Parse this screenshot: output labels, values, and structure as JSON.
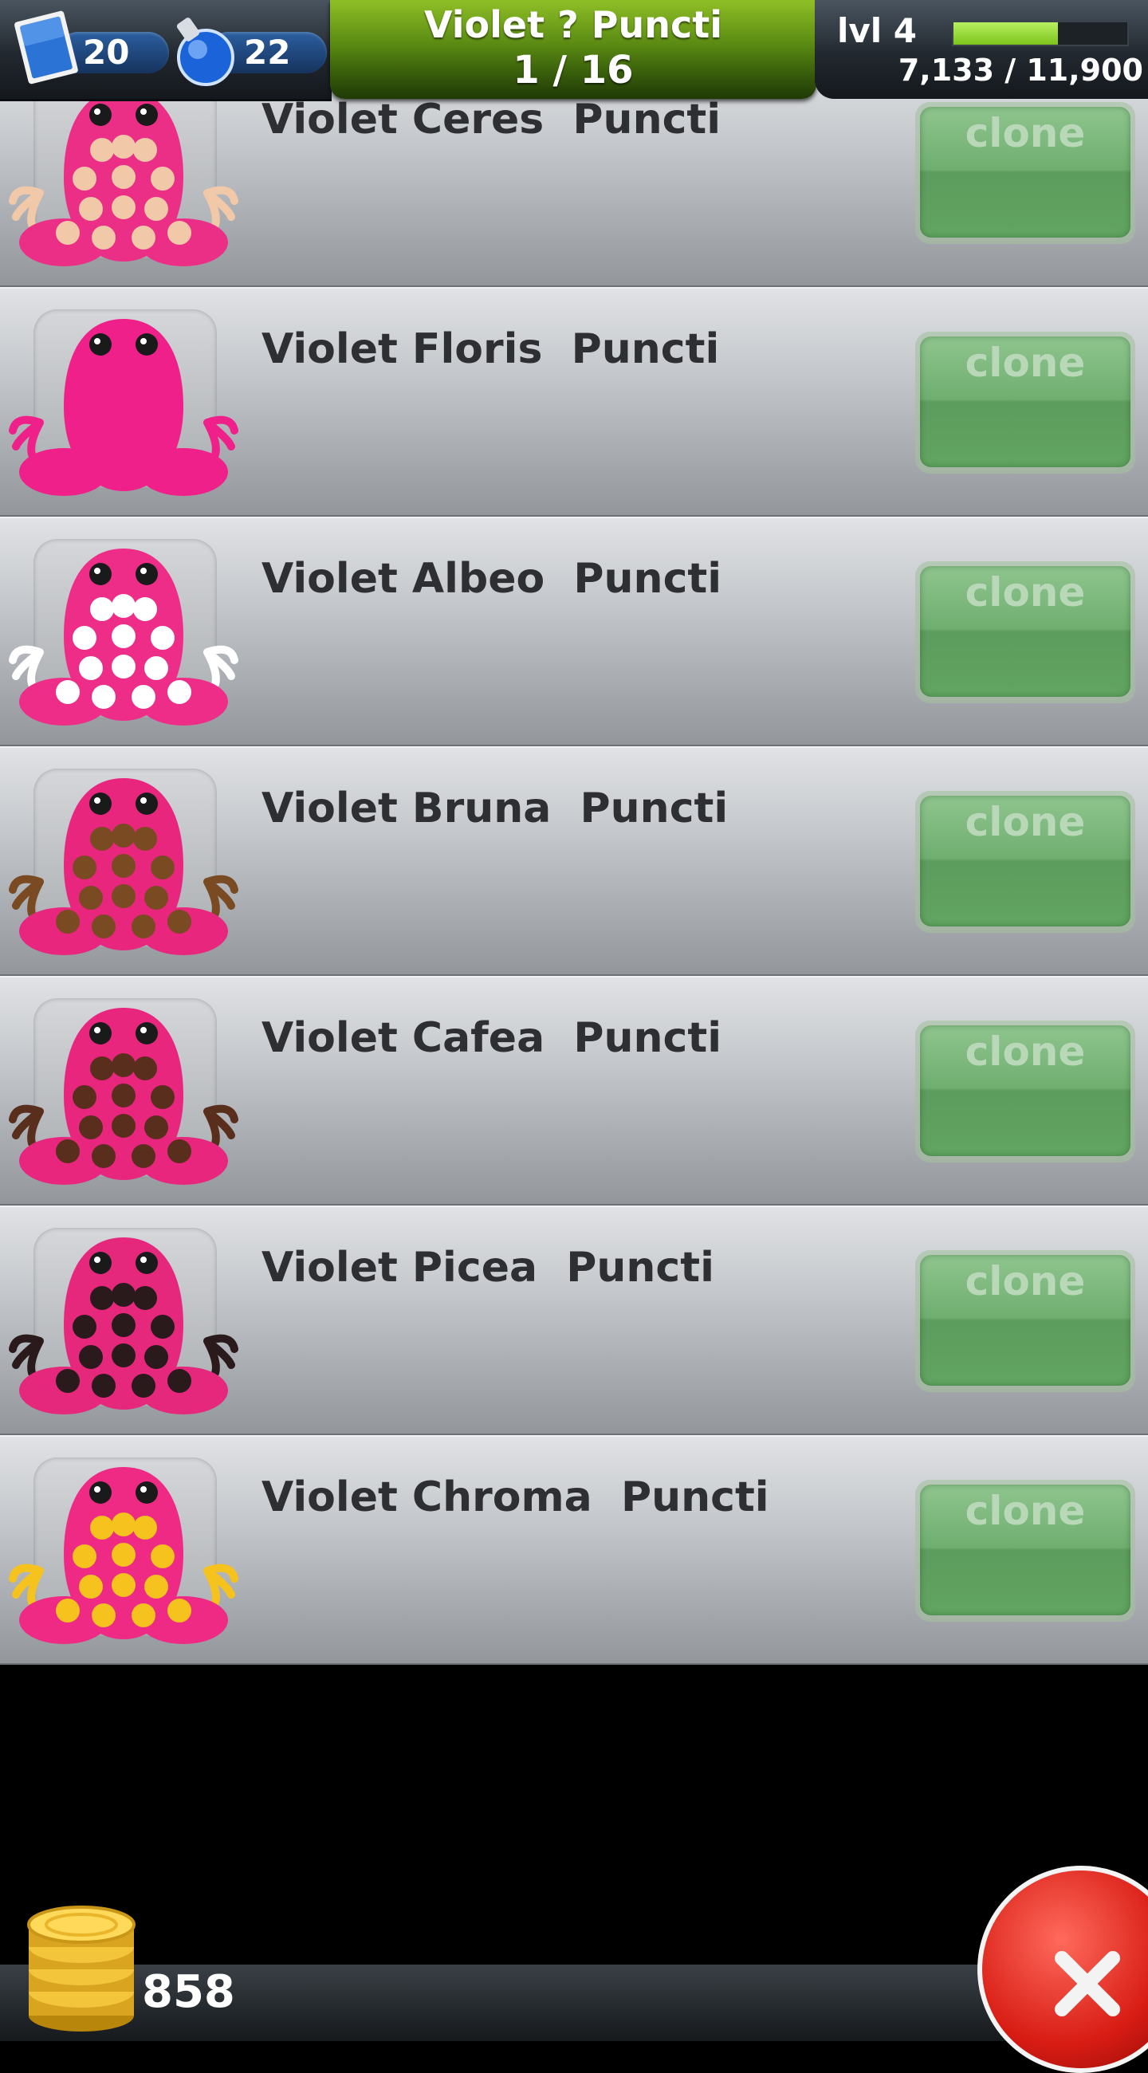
{
  "hud": {
    "stamps_count": "20",
    "potions_count": "22",
    "title": "Violet ? Puncti",
    "page": "1 / 16",
    "level": "lvl 4",
    "xp_text": "7,133 / 11,900",
    "xp_progress": 0.6
  },
  "list": {
    "items": [
      {
        "name": "Violet Ceres  Puncti",
        "button": "clone",
        "body_color": "#ec2f86",
        "spot_color": "#f2c9a8"
      },
      {
        "name": "Violet Floris  Puncti",
        "button": "clone",
        "body_color": "#f0208a",
        "spot_color": "#f0208a"
      },
      {
        "name": "Violet Albeo  Puncti",
        "button": "clone",
        "body_color": "#ee2d88",
        "spot_color": "#ffffff"
      },
      {
        "name": "Violet Bruna  Puncti",
        "button": "clone",
        "body_color": "#e8267e",
        "spot_color": "#7a4a22"
      },
      {
        "name": "Violet Cafea  Puncti",
        "button": "clone",
        "body_color": "#e8267e",
        "spot_color": "#5a2e1c"
      },
      {
        "name": "Violet Picea  Puncti",
        "button": "clone",
        "body_color": "#e6287c",
        "spot_color": "#2a1a1c"
      },
      {
        "name": "Violet Chroma  Puncti",
        "button": "clone",
        "body_color": "#ee2a84",
        "spot_color": "#f6c21e"
      }
    ]
  },
  "footer": {
    "coins": "858"
  }
}
